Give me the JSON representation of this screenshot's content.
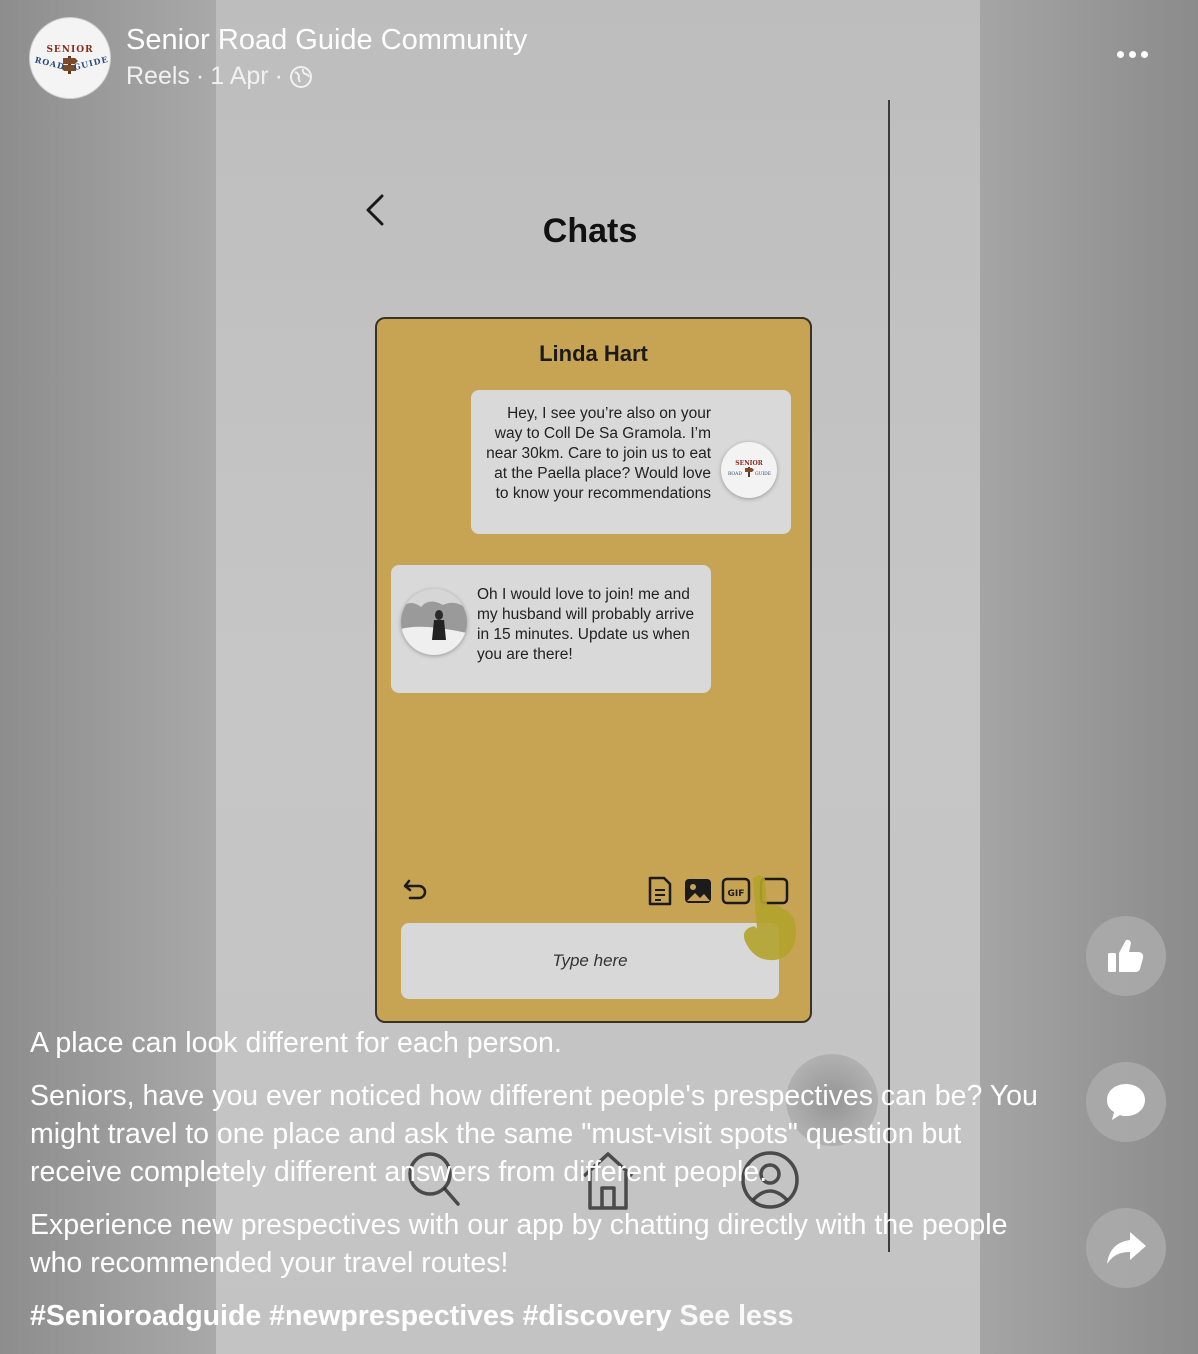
{
  "header": {
    "page_name": "Senior Road Guide Community",
    "meta_type": "Reels",
    "meta_separator": "·",
    "meta_date": "1 Apr",
    "more_icon": "more-horizontal-icon",
    "logo": {
      "top": "SENIOR",
      "bottom_left": "ROAD",
      "bottom_right": "GUIDE"
    }
  },
  "screen": {
    "title": "Chats",
    "back_icon": "chevron-left-icon",
    "chat": {
      "contact_name": "Linda Hart",
      "accent_color": "#c7a354",
      "messages": [
        {
          "text": "Hey, I see you’re also on your way to Coll De Sa Gramola. I’m near 30km. Care to join us to eat at the Paella place? Would love to know your recommendations"
        },
        {
          "text": "Oh I would love to join! me and my husband will probably arrive in 15 minutes. Update us when you are there!"
        }
      ],
      "input_placeholder": "Type here",
      "tool_icons": [
        "undo-icon",
        "document-icon",
        "image-icon",
        "gif-icon",
        "sticker-icon"
      ]
    },
    "bottom_nav": [
      "search-icon",
      "home-icon",
      "profile-icon"
    ]
  },
  "caption": {
    "line1": "A place can look different for each person.",
    "para2": "Seniors, have you ever noticed how different people's prespectives can be? You might travel to one place and ask the same \"must-visit spots\" question but receive completely different answers from different people.",
    "para3": "Experience new prespectives with our app by chatting directly with the people who recommended your travel routes!",
    "hashtags": "#Senioroadguide #newprespectives #discovery",
    "see_less": "See less"
  },
  "actions": [
    "like-icon",
    "comment-icon",
    "share-icon"
  ]
}
